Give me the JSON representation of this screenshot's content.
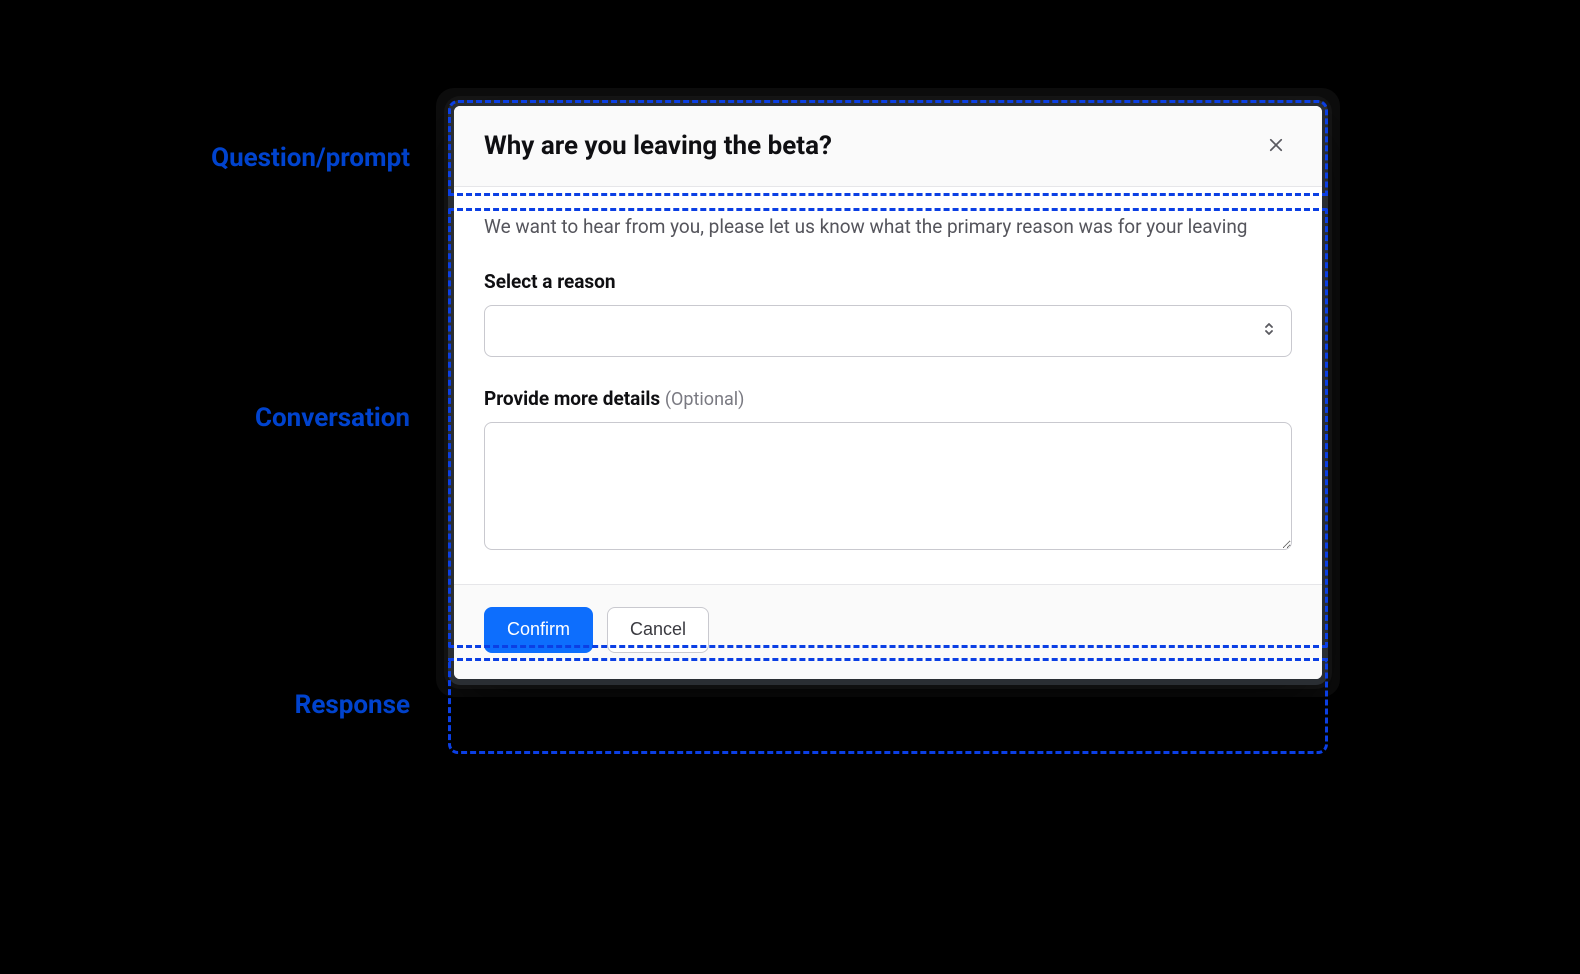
{
  "annotations": {
    "question_prompt": "Question/prompt",
    "conversation": "Conversation",
    "response": "Response"
  },
  "modal": {
    "title": "Why are you leaving the beta?",
    "close_label": "Close",
    "description": "We want to hear from you, please let us know what the primary reason was for your leaving",
    "fields": {
      "reason": {
        "label": "Select a reason",
        "value": ""
      },
      "details": {
        "label_main": "Provide more details",
        "label_optional": "(Optional)",
        "value": ""
      }
    },
    "buttons": {
      "confirm": "Confirm",
      "cancel": "Cancel"
    }
  },
  "colors": {
    "annotation_blue": "#0b3fe4",
    "primary_button": "#0d6efd",
    "modal_border": "#2a2e33"
  }
}
